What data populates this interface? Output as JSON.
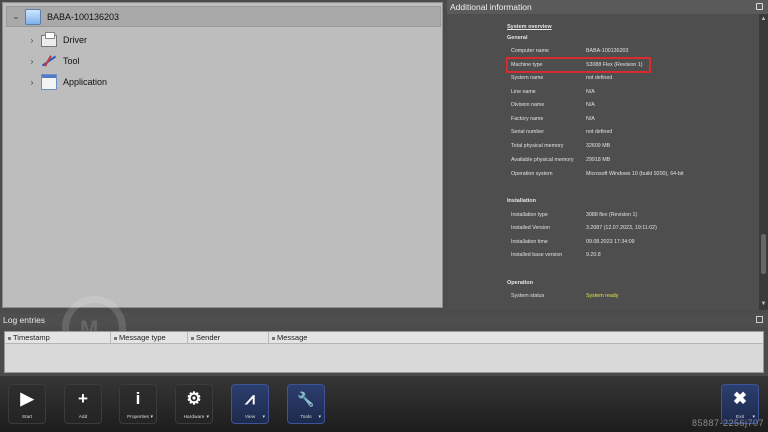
{
  "tree": {
    "root": "BABA-100136203",
    "children": [
      {
        "label": "Driver",
        "icon": "printer-icon"
      },
      {
        "label": "Tool",
        "icon": "tool-icon"
      },
      {
        "label": "Application",
        "icon": "application-icon"
      }
    ]
  },
  "info_panel": {
    "title": "Additional information",
    "overview_title": "System overview",
    "general": {
      "title": "General",
      "rows": [
        {
          "key": "Computer name",
          "value": "BABA-100136203"
        },
        {
          "key": "Machine type",
          "value": "S3088 Flex (Revision 1)"
        },
        {
          "key": "System name",
          "value": "not defined"
        },
        {
          "key": "Line name",
          "value": "N/A"
        },
        {
          "key": "Division name",
          "value": "N/A"
        },
        {
          "key": "Factory name",
          "value": "N/A"
        },
        {
          "key": "Serial number",
          "value": "not defined"
        },
        {
          "key": "Total physical memory",
          "value": "32609 MB"
        },
        {
          "key": "Available physical memory",
          "value": "29918 MB"
        },
        {
          "key": "Operation system",
          "value": "Microsoft Windows 10 (build 9200), 64-bit"
        }
      ]
    },
    "installation": {
      "title": "Installation",
      "rows": [
        {
          "key": "Installation type",
          "value": "3088 flex (Revision 1)"
        },
        {
          "key": "Installed Version",
          "value": "3.2087 (12.07.2023, 19:11:02)"
        },
        {
          "key": "Installation time",
          "value": "09.08.2023 17:34:09"
        },
        {
          "key": "Installed base version",
          "value": "9.20.8"
        }
      ]
    },
    "operation": {
      "title": "Operation",
      "rows": [
        {
          "key": "System status",
          "value": "System ready"
        }
      ]
    },
    "highlight_color": "#d92b2b",
    "ready_color": "#e4e24a"
  },
  "log": {
    "title": "Log entries",
    "columns": [
      "Timestamp",
      "Message type",
      "Sender",
      "Message"
    ]
  },
  "toolbar": {
    "buttons": [
      {
        "label": "Start",
        "icon": "play-icon",
        "glyph": "▶"
      },
      {
        "label": "Add",
        "icon": "plus-icon",
        "glyph": "+"
      },
      {
        "label": "Properties",
        "icon": "info-icon",
        "glyph": "i"
      },
      {
        "label": "Hardware",
        "icon": "gear-icon",
        "glyph": "⚙"
      },
      {
        "label": "View",
        "icon": "view-icon",
        "glyph": "⩘"
      },
      {
        "label": "Tools",
        "icon": "wrench-icon",
        "glyph": "🔧"
      },
      {
        "label": "Exit",
        "icon": "close-icon",
        "glyph": "✖"
      }
    ],
    "active_color": "#2c3e6e"
  },
  "corner_text": "85887-2256j707"
}
